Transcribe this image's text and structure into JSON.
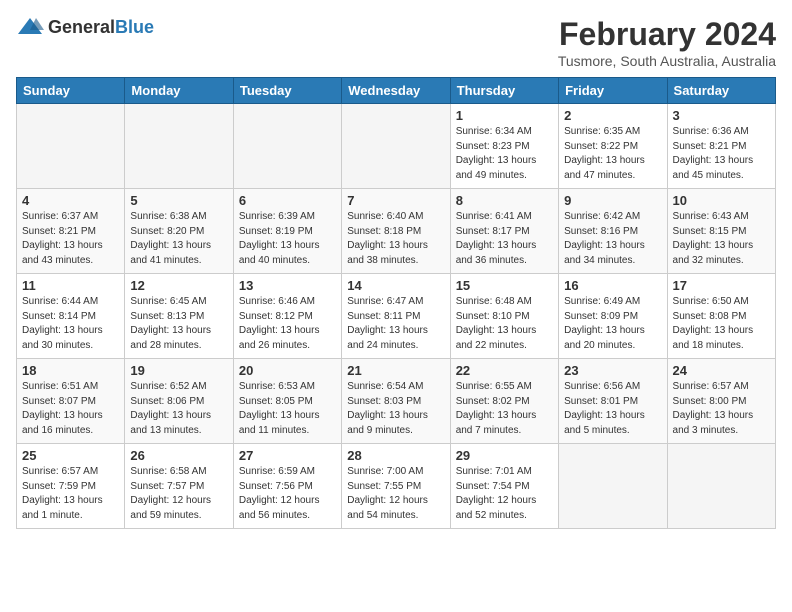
{
  "header": {
    "logo_general": "General",
    "logo_blue": "Blue",
    "title": "February 2024",
    "subtitle": "Tusmore, South Australia, Australia"
  },
  "weekdays": [
    "Sunday",
    "Monday",
    "Tuesday",
    "Wednesday",
    "Thursday",
    "Friday",
    "Saturday"
  ],
  "weeks": [
    [
      {
        "day": "",
        "info": "",
        "empty": true
      },
      {
        "day": "",
        "info": "",
        "empty": true
      },
      {
        "day": "",
        "info": "",
        "empty": true
      },
      {
        "day": "",
        "info": "",
        "empty": true
      },
      {
        "day": "1",
        "info": "Sunrise: 6:34 AM\nSunset: 8:23 PM\nDaylight: 13 hours\nand 49 minutes.",
        "empty": false
      },
      {
        "day": "2",
        "info": "Sunrise: 6:35 AM\nSunset: 8:22 PM\nDaylight: 13 hours\nand 47 minutes.",
        "empty": false
      },
      {
        "day": "3",
        "info": "Sunrise: 6:36 AM\nSunset: 8:21 PM\nDaylight: 13 hours\nand 45 minutes.",
        "empty": false
      }
    ],
    [
      {
        "day": "4",
        "info": "Sunrise: 6:37 AM\nSunset: 8:21 PM\nDaylight: 13 hours\nand 43 minutes.",
        "empty": false
      },
      {
        "day": "5",
        "info": "Sunrise: 6:38 AM\nSunset: 8:20 PM\nDaylight: 13 hours\nand 41 minutes.",
        "empty": false
      },
      {
        "day": "6",
        "info": "Sunrise: 6:39 AM\nSunset: 8:19 PM\nDaylight: 13 hours\nand 40 minutes.",
        "empty": false
      },
      {
        "day": "7",
        "info": "Sunrise: 6:40 AM\nSunset: 8:18 PM\nDaylight: 13 hours\nand 38 minutes.",
        "empty": false
      },
      {
        "day": "8",
        "info": "Sunrise: 6:41 AM\nSunset: 8:17 PM\nDaylight: 13 hours\nand 36 minutes.",
        "empty": false
      },
      {
        "day": "9",
        "info": "Sunrise: 6:42 AM\nSunset: 8:16 PM\nDaylight: 13 hours\nand 34 minutes.",
        "empty": false
      },
      {
        "day": "10",
        "info": "Sunrise: 6:43 AM\nSunset: 8:15 PM\nDaylight: 13 hours\nand 32 minutes.",
        "empty": false
      }
    ],
    [
      {
        "day": "11",
        "info": "Sunrise: 6:44 AM\nSunset: 8:14 PM\nDaylight: 13 hours\nand 30 minutes.",
        "empty": false
      },
      {
        "day": "12",
        "info": "Sunrise: 6:45 AM\nSunset: 8:13 PM\nDaylight: 13 hours\nand 28 minutes.",
        "empty": false
      },
      {
        "day": "13",
        "info": "Sunrise: 6:46 AM\nSunset: 8:12 PM\nDaylight: 13 hours\nand 26 minutes.",
        "empty": false
      },
      {
        "day": "14",
        "info": "Sunrise: 6:47 AM\nSunset: 8:11 PM\nDaylight: 13 hours\nand 24 minutes.",
        "empty": false
      },
      {
        "day": "15",
        "info": "Sunrise: 6:48 AM\nSunset: 8:10 PM\nDaylight: 13 hours\nand 22 minutes.",
        "empty": false
      },
      {
        "day": "16",
        "info": "Sunrise: 6:49 AM\nSunset: 8:09 PM\nDaylight: 13 hours\nand 20 minutes.",
        "empty": false
      },
      {
        "day": "17",
        "info": "Sunrise: 6:50 AM\nSunset: 8:08 PM\nDaylight: 13 hours\nand 18 minutes.",
        "empty": false
      }
    ],
    [
      {
        "day": "18",
        "info": "Sunrise: 6:51 AM\nSunset: 8:07 PM\nDaylight: 13 hours\nand 16 minutes.",
        "empty": false
      },
      {
        "day": "19",
        "info": "Sunrise: 6:52 AM\nSunset: 8:06 PM\nDaylight: 13 hours\nand 13 minutes.",
        "empty": false
      },
      {
        "day": "20",
        "info": "Sunrise: 6:53 AM\nSunset: 8:05 PM\nDaylight: 13 hours\nand 11 minutes.",
        "empty": false
      },
      {
        "day": "21",
        "info": "Sunrise: 6:54 AM\nSunset: 8:03 PM\nDaylight: 13 hours\nand 9 minutes.",
        "empty": false
      },
      {
        "day": "22",
        "info": "Sunrise: 6:55 AM\nSunset: 8:02 PM\nDaylight: 13 hours\nand 7 minutes.",
        "empty": false
      },
      {
        "day": "23",
        "info": "Sunrise: 6:56 AM\nSunset: 8:01 PM\nDaylight: 13 hours\nand 5 minutes.",
        "empty": false
      },
      {
        "day": "24",
        "info": "Sunrise: 6:57 AM\nSunset: 8:00 PM\nDaylight: 13 hours\nand 3 minutes.",
        "empty": false
      }
    ],
    [
      {
        "day": "25",
        "info": "Sunrise: 6:57 AM\nSunset: 7:59 PM\nDaylight: 13 hours\nand 1 minute.",
        "empty": false
      },
      {
        "day": "26",
        "info": "Sunrise: 6:58 AM\nSunset: 7:57 PM\nDaylight: 12 hours\nand 59 minutes.",
        "empty": false
      },
      {
        "day": "27",
        "info": "Sunrise: 6:59 AM\nSunset: 7:56 PM\nDaylight: 12 hours\nand 56 minutes.",
        "empty": false
      },
      {
        "day": "28",
        "info": "Sunrise: 7:00 AM\nSunset: 7:55 PM\nDaylight: 12 hours\nand 54 minutes.",
        "empty": false
      },
      {
        "day": "29",
        "info": "Sunrise: 7:01 AM\nSunset: 7:54 PM\nDaylight: 12 hours\nand 52 minutes.",
        "empty": false
      },
      {
        "day": "",
        "info": "",
        "empty": true
      },
      {
        "day": "",
        "info": "",
        "empty": true
      }
    ]
  ]
}
